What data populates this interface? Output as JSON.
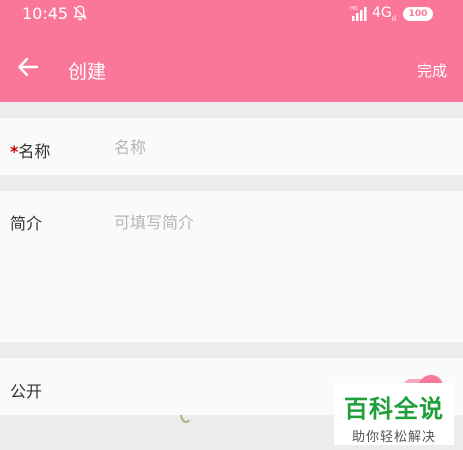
{
  "status_bar": {
    "time": "10:45",
    "icons": [
      "bell-off-icon",
      "signal-icon"
    ],
    "network": "4G",
    "network_sub": "ıl",
    "battery": "100"
  },
  "app_bar": {
    "title": "创建",
    "done_label": "完成",
    "back_icon": "arrow-left-icon",
    "color": "#fb7799"
  },
  "form": {
    "name": {
      "required_mark": "*",
      "label": "名称",
      "placeholder": "名称",
      "value": ""
    },
    "description": {
      "label": "简介",
      "placeholder": "可填写简介",
      "value": ""
    },
    "public": {
      "label": "公开",
      "enabled": true
    }
  },
  "watermark": {
    "main": "百科全说",
    "sub": "助你轻松解决"
  }
}
